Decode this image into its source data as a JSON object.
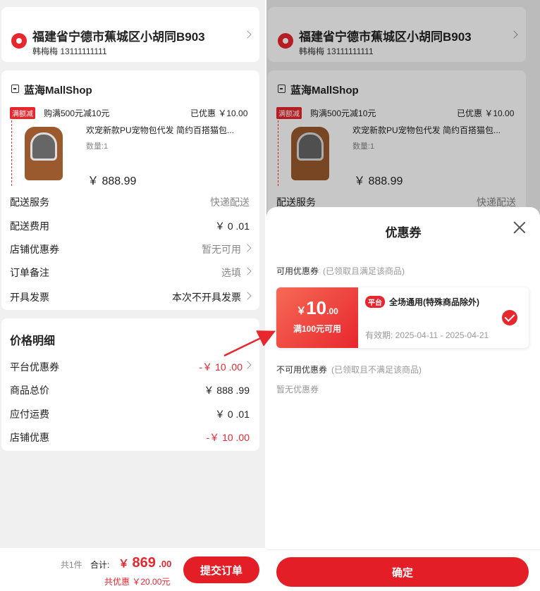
{
  "order": {
    "address": {
      "title": "福建省宁德市蕉城区小胡同B903",
      "contact": "韩梅梅 13111111111"
    },
    "shop": {
      "name": "蓝海MallShop",
      "promo_badge": "满额减",
      "promo_text": "购满500元减10元",
      "discount_text": "已优惠 ￥10.00",
      "product_title": "欢宠新款PU宠物包代发 简约百搭猫包...",
      "quantity": "数量:1",
      "price": "￥ 888.99"
    },
    "rows": [
      {
        "label": "配送服务",
        "value": "快递配送"
      },
      {
        "label": "配送费用",
        "value": "￥ 0 .01"
      },
      {
        "label": "店铺优惠券",
        "value": "暂无可用"
      },
      {
        "label": "订单备注",
        "value": "选填"
      },
      {
        "label": "开具发票",
        "value": "本次不开具发票"
      }
    ],
    "price_detail": {
      "title": "价格明细",
      "rows": [
        {
          "label": "平台优惠券",
          "value": "-￥ 10 .00"
        },
        {
          "label": "商品总价",
          "value": "￥ 888 .99"
        },
        {
          "label": "应付运费",
          "value": "￥ 0 .01"
        },
        {
          "label": "店铺优惠",
          "value": "-￥ 10 .00"
        }
      ]
    },
    "footer": {
      "count": "共1件",
      "total_label": "合计:",
      "total_symbol": "￥",
      "total_int": "869",
      "total_dec": ".00",
      "saved": "共优惠 ￥20.00元",
      "submit": "提交订单"
    }
  },
  "coupon_sheet": {
    "title": "优惠券",
    "available_title": "可用优惠券",
    "available_note": "(已领取且满足该商品)",
    "coupon": {
      "symbol": "￥",
      "amount": "10",
      "decimals": ".00",
      "condition": "满100元可用",
      "tag": "平台",
      "name": "全场通用(特殊商品除外)",
      "validity": "有效期: 2025-04-11 - 2025-04-21"
    },
    "unavailable_title": "不可用优惠券",
    "unavailable_note": "(已领取且不满足该商品)",
    "none_text": "暂无优惠券",
    "confirm": "确定"
  },
  "colors": {
    "accent": "#e8262e",
    "muted": "#888888"
  }
}
